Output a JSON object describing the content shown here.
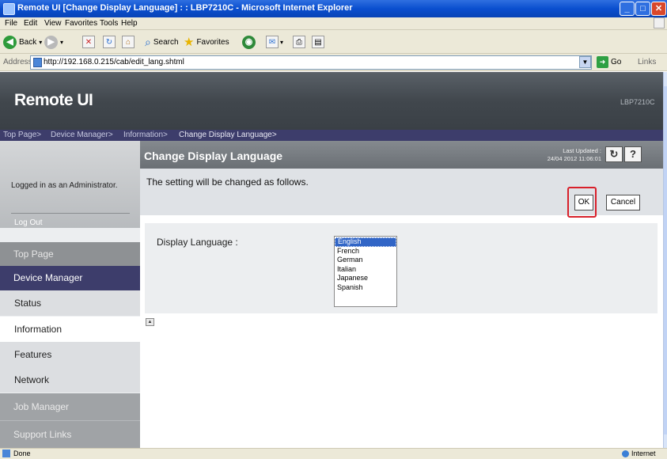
{
  "window": {
    "title": "Remote UI [Change Display Language] : : LBP7210C - Microsoft Internet Explorer",
    "controls": {
      "minimize": "_",
      "maximize": "□",
      "close": "✕"
    }
  },
  "menubar": [
    "File",
    "Edit",
    "View",
    "Favorites",
    "Tools",
    "Help"
  ],
  "toolbar": {
    "back": "Back",
    "search": "Search",
    "favorites": "Favorites"
  },
  "addressbar": {
    "label": "Address",
    "url": "http://192.168.0.215/cab/edit_lang.shtml",
    "go": "Go",
    "links": "Links"
  },
  "header": {
    "logo": "Remote UI",
    "model": "LBP7210C"
  },
  "breadcrumb": [
    "Top Page>",
    "Device Manager>",
    "Information>",
    "Change Display Language>"
  ],
  "sidebar": {
    "login_text": "Logged in as an Administrator.",
    "logout": "Log Out",
    "top_page": "Top Page",
    "device_manager": "Device Manager",
    "items": [
      "Status",
      "Information",
      "Features",
      "Network"
    ],
    "job_manager": "Job Manager",
    "support_links": "Support Links"
  },
  "main": {
    "title": "Change Display Language",
    "last_updated_label": "Last Updated :",
    "last_updated_value": "24/04 2012 11:06:01",
    "refresh_icon": "↻",
    "help_icon": "?",
    "notice": "The setting will be changed as follows.",
    "ok": "OK",
    "cancel": "Cancel",
    "setting_label": "Display Language :",
    "languages": [
      "English",
      "French",
      "German",
      "Italian",
      "Japanese",
      "Spanish"
    ],
    "selected_language": "English"
  },
  "statusbar": {
    "left": "Done",
    "zone": "Internet"
  },
  "colors": {
    "titlebar": "#0a4fcf",
    "header": "#41474d",
    "breadcrumb": "#3d3d6b",
    "sidebar_active": "#3d3d6b",
    "highlight": "#d8202a"
  }
}
